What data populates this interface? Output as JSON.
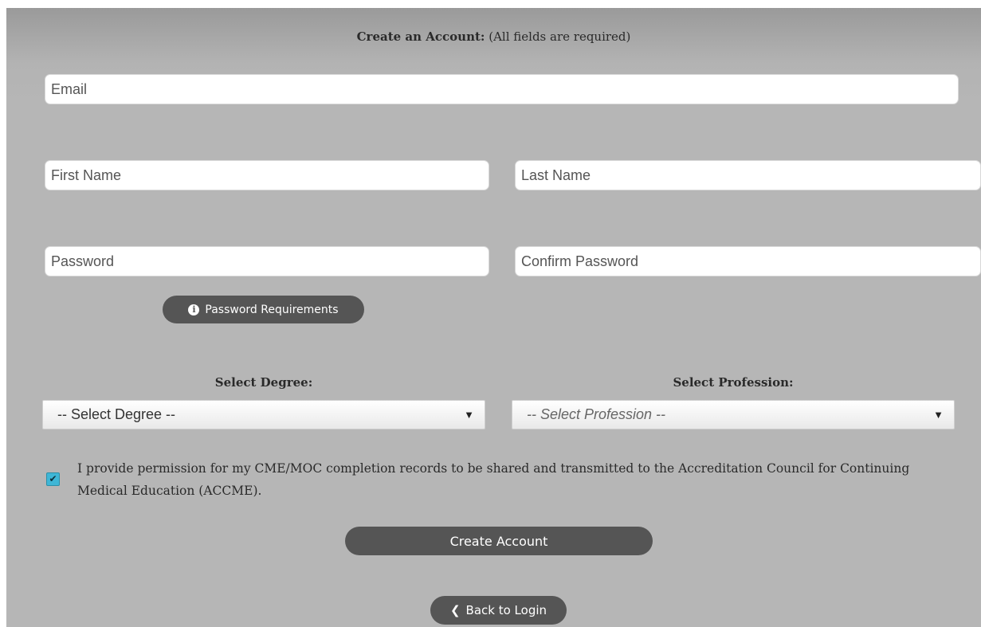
{
  "form": {
    "title_bold": "Create an Account:",
    "title_rest": " (All fields are required)",
    "email_placeholder": "Email",
    "first_name_placeholder": "First Name",
    "last_name_placeholder": "Last Name",
    "password_placeholder": "Password",
    "confirm_password_placeholder": "Confirm Password",
    "password_requirements_label": "Password Requirements",
    "password_requirements_icon": "info-circle-icon",
    "degree_label": "Select Degree:",
    "degree_selected": "-- Select Degree --",
    "profession_label": "Select Profession:",
    "profession_selected": "-- Select Profession --",
    "consent_checked": true,
    "consent_text": "I provide permission for my CME/MOC completion records to be shared and transmitted to the Accreditation Council for Continuing Medical Education (ACCME).",
    "create_account_label": "Create Account",
    "back_to_login_label": "Back to Login",
    "back_icon": "chevron-left-icon",
    "caret_icon": "caret-down-icon"
  },
  "colors": {
    "panel_bg": "#b6b6b6",
    "button_bg": "#555555",
    "checkbox_accent": "#3fb6d6"
  }
}
